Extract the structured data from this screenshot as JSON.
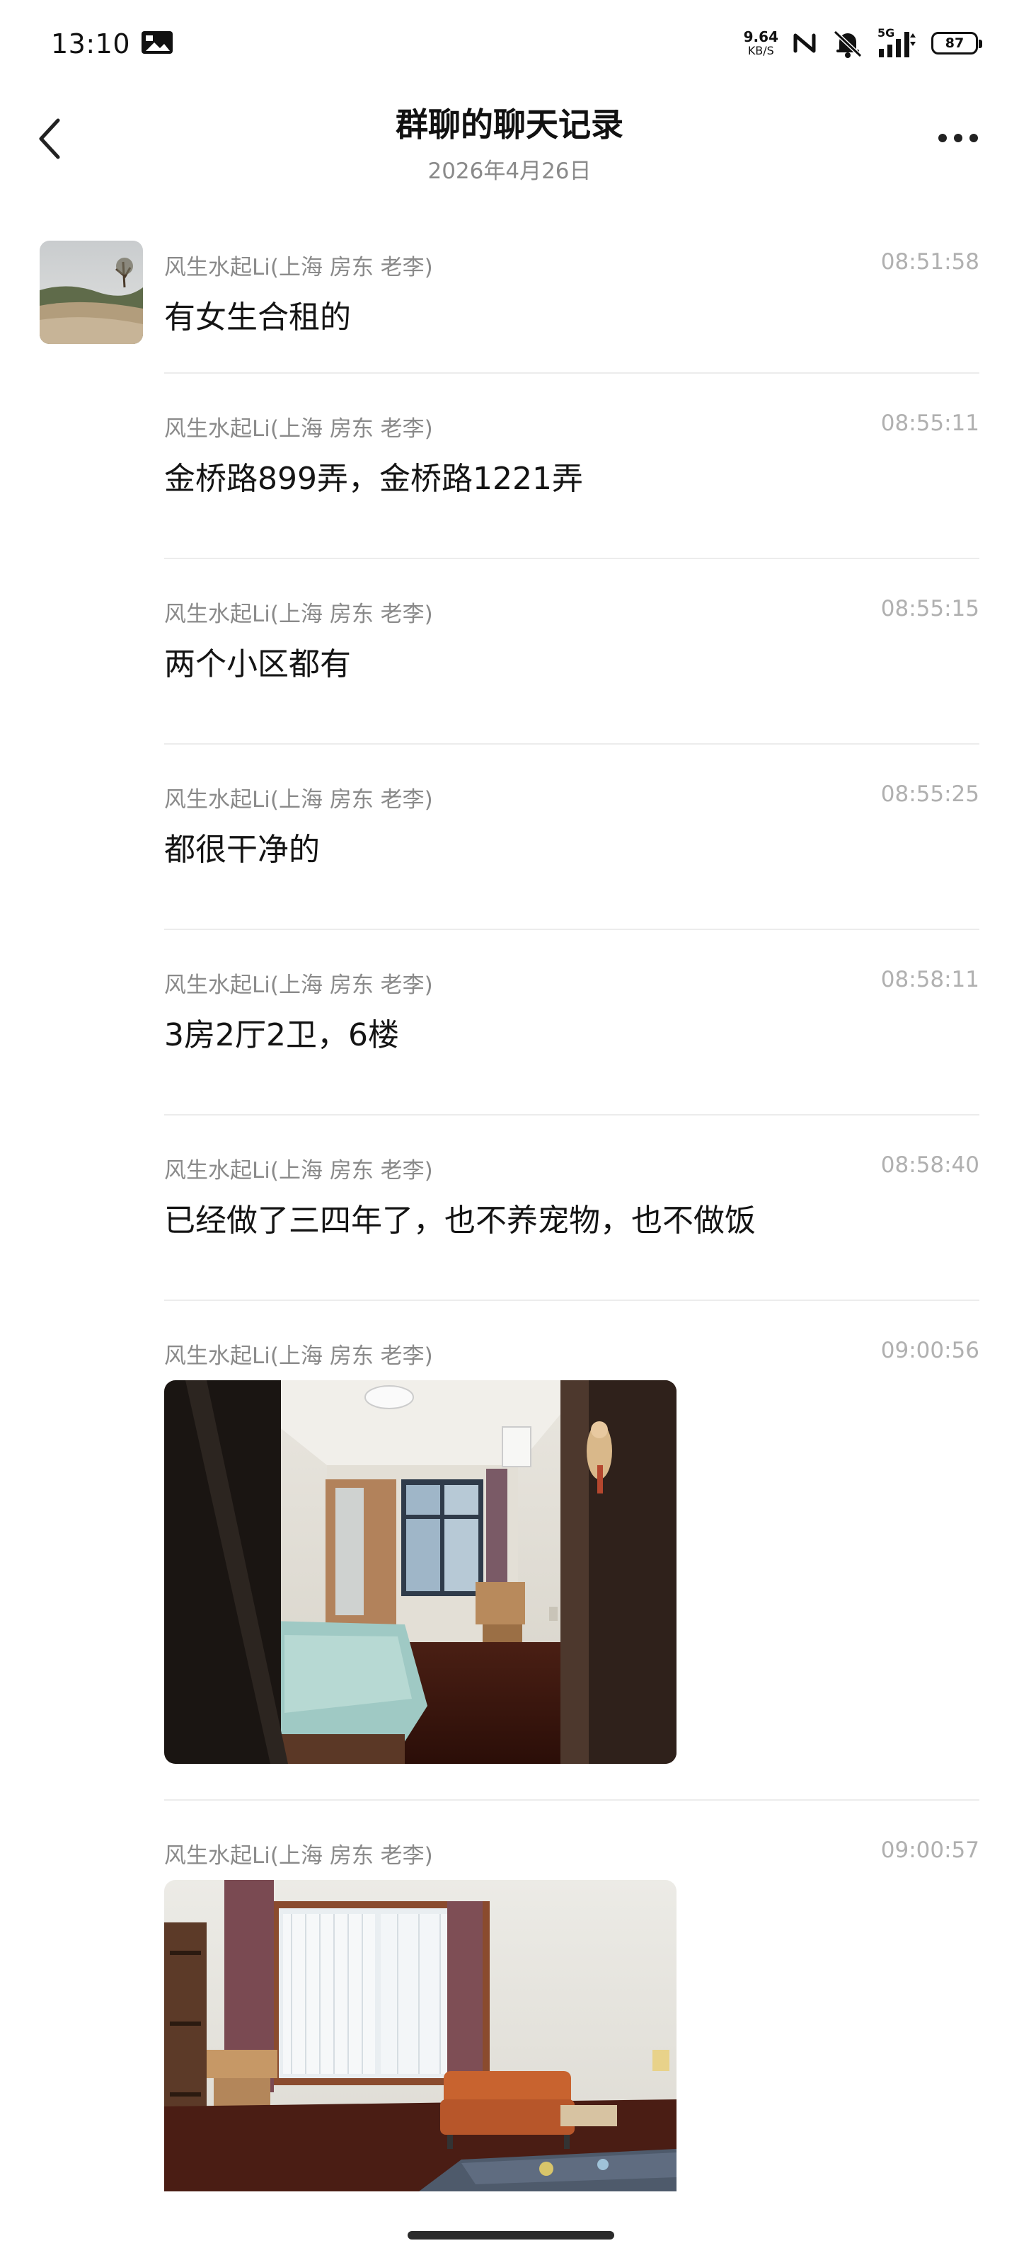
{
  "status_bar": {
    "time": "13:10",
    "net_speed_value": "9.64",
    "net_speed_unit": "KB/S",
    "signal_label": "5G",
    "battery": "87",
    "icons": [
      "notification-image-icon",
      "nfc-icon",
      "silent-bell-icon",
      "signal-5g-icon",
      "battery-icon"
    ]
  },
  "header": {
    "title": "群聊的聊天记录",
    "subtitle": "2026年4月26日",
    "back_icon": "chevron-left-icon",
    "more_icon": "more-dots-icon"
  },
  "messages": [
    {
      "sender": "风生水起Li(上海  房东  老李)",
      "time": "08:51:58",
      "type": "text",
      "text": "有女生合租的"
    },
    {
      "sender": "风生水起Li(上海  房东  老李)",
      "time": "08:55:11",
      "type": "text",
      "text": "金桥路899弄，金桥路1221弄"
    },
    {
      "sender": "风生水起Li(上海  房东  老李)",
      "time": "08:55:15",
      "type": "text",
      "text": "两个小区都有"
    },
    {
      "sender": "风生水起Li(上海  房东  老李)",
      "time": "08:55:25",
      "type": "text",
      "text": "都很干净的"
    },
    {
      "sender": "风生水起Li(上海  房东  老李)",
      "time": "08:58:11",
      "type": "text",
      "text": "3房2厅2卫，6楼"
    },
    {
      "sender": "风生水起Li(上海  房东  老李)",
      "time": "08:58:40",
      "type": "text",
      "text": "已经做了三四年了，也不养宠物，也不做饭"
    },
    {
      "sender": "风生水起Li(上海  房东  老李)",
      "time": "09:00:56",
      "type": "image"
    },
    {
      "sender": "风生水起Li(上海  房东  老李)",
      "time": "09:00:57",
      "type": "image"
    }
  ],
  "colors": {
    "text_primary": "#141414",
    "text_secondary": "#8a8a8a",
    "timestamp": "#b0b0b0",
    "divider": "#ececec",
    "background": "#ffffff"
  }
}
